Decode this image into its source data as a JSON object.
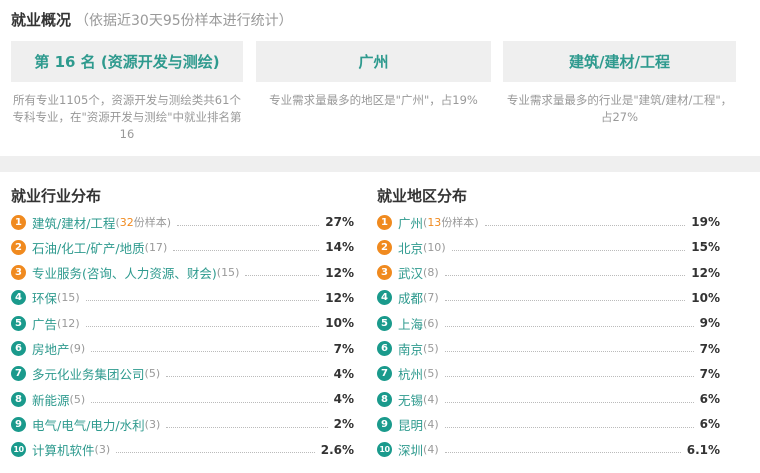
{
  "overview": {
    "title": "就业概况",
    "note": "（依据近30天95份样本进行统计）",
    "cards": [
      {
        "label": "第 16 名 (资源开发与测绘)",
        "desc": "所有专业1105个，资源开发与测绘类共61个专科专业，在\"资源开发与测绘\"中就业排名第16"
      },
      {
        "label": "广州",
        "desc": "专业需求量最多的地区是\"广州\"，占19%"
      },
      {
        "label": "建筑/建材/工程",
        "desc": "专业需求量最多的行业是\"建筑/建材/工程\"，占27%"
      }
    ]
  },
  "industry": {
    "title": "就业行业分布",
    "sample_suffix": "份样本",
    "items": [
      {
        "rank": "1",
        "name": "建筑/建材/工程",
        "count": "32",
        "pct": "27%"
      },
      {
        "rank": "2",
        "name": "石油/化工/矿产/地质",
        "count": "17",
        "pct": "14%"
      },
      {
        "rank": "3",
        "name": "专业服务(咨询、人力资源、财会)",
        "count": "15",
        "pct": "12%"
      },
      {
        "rank": "4",
        "name": "环保",
        "count": "15",
        "pct": "12%"
      },
      {
        "rank": "5",
        "name": "广告",
        "count": "12",
        "pct": "10%"
      },
      {
        "rank": "6",
        "name": "房地产",
        "count": "9",
        "pct": "7%"
      },
      {
        "rank": "7",
        "name": "多元化业务集团公司",
        "count": "5",
        "pct": "4%"
      },
      {
        "rank": "8",
        "name": "新能源",
        "count": "5",
        "pct": "4%"
      },
      {
        "rank": "9",
        "name": "电气/电气/电力/水利",
        "count": "3",
        "pct": "2%"
      },
      {
        "rank": "10",
        "name": "计算机软件",
        "count": "3",
        "pct": "2.6%"
      }
    ]
  },
  "region": {
    "title": "就业地区分布",
    "sample_suffix": "份样本",
    "items": [
      {
        "rank": "1",
        "name": "广州",
        "count": "13",
        "pct": "19%"
      },
      {
        "rank": "2",
        "name": "北京",
        "count": "10",
        "pct": "15%"
      },
      {
        "rank": "3",
        "name": "武汉",
        "count": "8",
        "pct": "12%"
      },
      {
        "rank": "4",
        "name": "成都",
        "count": "7",
        "pct": "10%"
      },
      {
        "rank": "5",
        "name": "上海",
        "count": "6",
        "pct": "9%"
      },
      {
        "rank": "6",
        "name": "南京",
        "count": "5",
        "pct": "7%"
      },
      {
        "rank": "7",
        "name": "杭州",
        "count": "5",
        "pct": "7%"
      },
      {
        "rank": "8",
        "name": "无锡",
        "count": "4",
        "pct": "6%"
      },
      {
        "rank": "9",
        "name": "昆明",
        "count": "4",
        "pct": "6%"
      },
      {
        "rank": "10",
        "name": "深圳",
        "count": "4",
        "pct": "6.1%"
      }
    ]
  },
  "colors": {
    "accent": "#2e9a8e",
    "rank_top": "#f08a1f",
    "rank_other": "#1a9a8c"
  }
}
